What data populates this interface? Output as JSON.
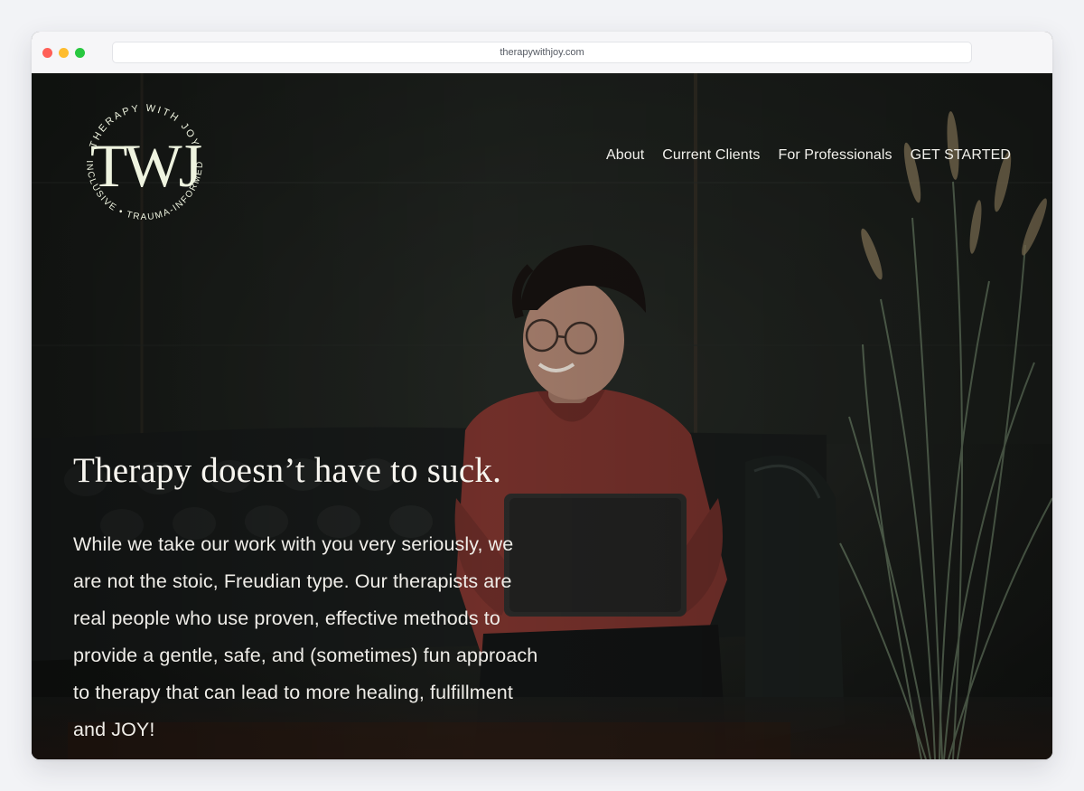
{
  "browser": {
    "url": "therapywithjoy.com"
  },
  "logo": {
    "monogram": "TWJ",
    "top_arc": "THERAPY WITH JOY",
    "bottom_arc": "INCLUSIVE • TRAUMA-INFORMED"
  },
  "nav": {
    "items": [
      {
        "label": "About"
      },
      {
        "label": "Current Clients"
      },
      {
        "label": "For Professionals"
      },
      {
        "label": "GET STARTED"
      }
    ]
  },
  "hero": {
    "headline": "Therapy doesn’t have to suck.",
    "body": "While we take our work with you very seriously, we are not the stoic, Freudian type. Our therapists are real people who use proven, effective methods to provide a gentle, safe, and (sometimes) fun approach to therapy that can lead to more healing, fulfillment and JOY!",
    "image_subject": "smiling-person-with-laptop-on-leather-couch"
  },
  "colors": {
    "background": "#f2f3f6",
    "hero_overlay": "#151816",
    "logo_cream": "#eef3df",
    "text_light": "#f7f5ef",
    "sweater": "#8d3b33"
  }
}
